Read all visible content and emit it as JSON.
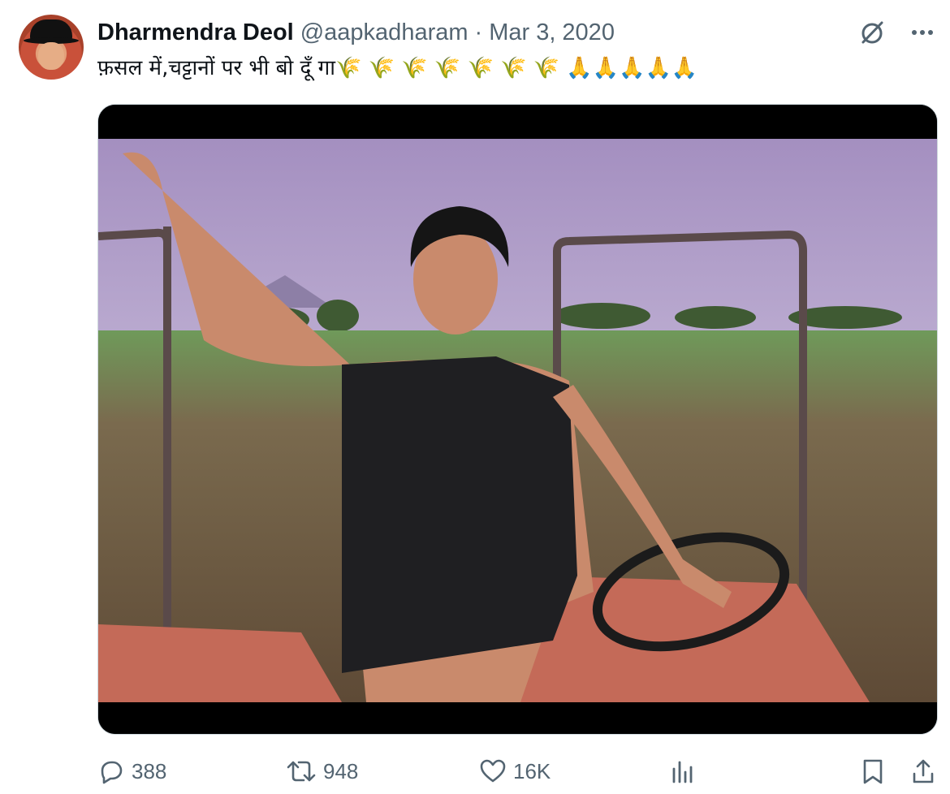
{
  "author": {
    "name": "Dharmendra Deol",
    "handle": "@aapkadharam",
    "separator": "·",
    "date": "Mar 3, 2020"
  },
  "tweet": {
    "text": "फ़सल में,चट्टानों पर भी बो दूँ गा🌾 🌾 🌾 🌾 🌾 🌾 🌾 🙏🙏🙏🙏🙏"
  },
  "media": {
    "description_icon": "video-still-icon"
  },
  "actions": {
    "replies": "388",
    "retweets": "948",
    "likes": "16K"
  },
  "icons": {
    "reply": "reply-icon",
    "retweet": "retweet-icon",
    "like": "heart-icon",
    "views": "analytics-icon",
    "bookmark": "bookmark-icon",
    "share": "share-icon",
    "grok": "grok-icon",
    "more": "more-icon"
  },
  "colors": {
    "text_primary": "#0f1419",
    "text_secondary": "#536471",
    "border": "#cfd9de"
  }
}
